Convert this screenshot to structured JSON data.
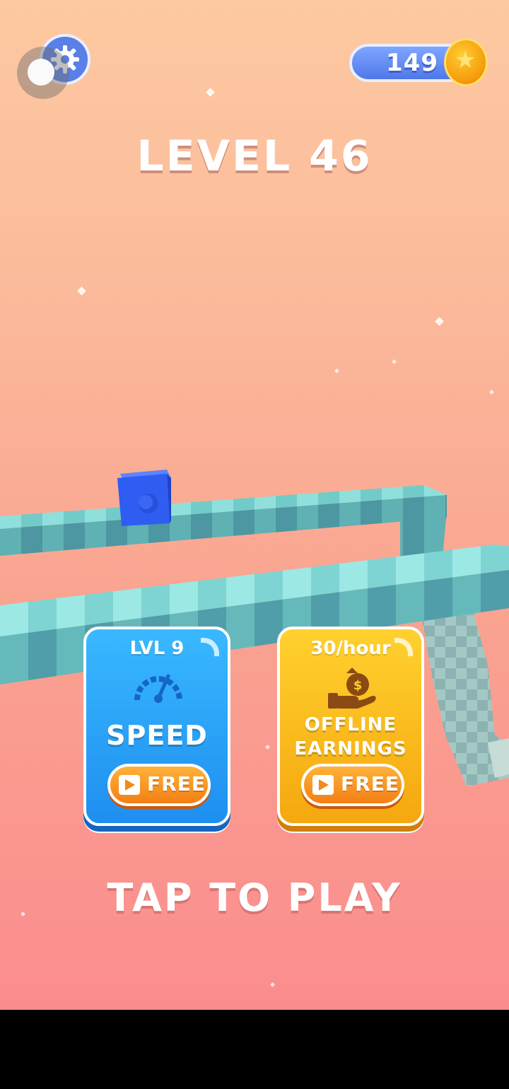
{
  "hud": {
    "coins": "149",
    "settings_icon": "gear-icon",
    "coin_icon": "coin-icon"
  },
  "level": {
    "title": "LEVEL 46"
  },
  "upgrades": {
    "speed": {
      "level": "LVL 9",
      "title": "SPEED",
      "icon": "speedometer-icon",
      "button": "FREE",
      "button_icon": "video-icon",
      "color": "#2a9ff5"
    },
    "offline": {
      "rate": "30/hour",
      "title_line1": "OFFLINE",
      "title_line2": "EARNINGS",
      "icon": "money-bag-hand-icon",
      "button": "FREE",
      "button_icon": "video-icon",
      "color": "#f7b51c"
    }
  },
  "cta": {
    "label": "TAP TO PLAY"
  },
  "colors": {
    "sky_top": "#fdc9a1",
    "sky_bottom": "#fb8c8e",
    "track": "#7fd3cf",
    "player": "#2d59f0"
  }
}
